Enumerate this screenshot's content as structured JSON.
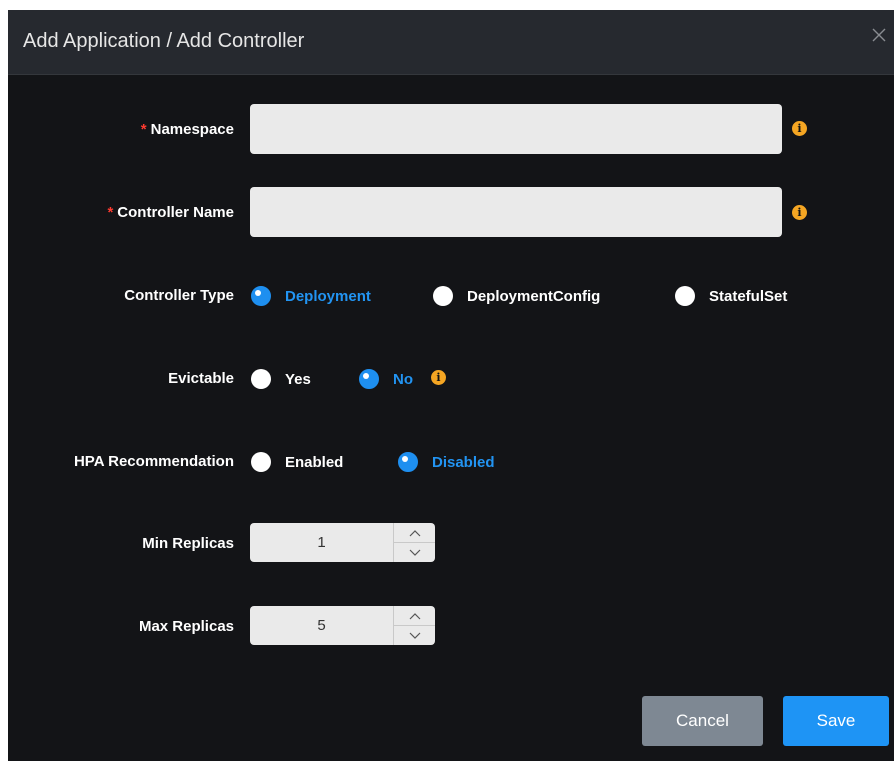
{
  "dialog": {
    "title": "Add Application / Add Controller",
    "close_icon": "close-icon"
  },
  "form": {
    "required_marker": "*",
    "namespace": {
      "label": "Namespace",
      "value": "",
      "required": true
    },
    "controller_name": {
      "label": "Controller Name",
      "value": "",
      "required": true
    },
    "controller_type": {
      "label": "Controller Type",
      "options": [
        "Deployment",
        "DeploymentConfig",
        "StatefulSet"
      ],
      "selected": "Deployment"
    },
    "evictable": {
      "label": "Evictable",
      "options": [
        "Yes",
        "No"
      ],
      "selected": "No"
    },
    "hpa_recommendation": {
      "label": "HPA Recommendation",
      "options": [
        "Enabled",
        "Disabled"
      ],
      "selected": "Disabled"
    },
    "min_replicas": {
      "label": "Min Replicas",
      "value": "1"
    },
    "max_replicas": {
      "label": "Max Replicas",
      "value": "5"
    },
    "info_icon_glyph": "i"
  },
  "footer": {
    "cancel_label": "Cancel",
    "save_label": "Save"
  },
  "colors": {
    "background": "#131417",
    "header": "#26292f",
    "accent": "#1e8ff0",
    "info": "#f5a623",
    "required": "#ff3b30",
    "cancel": "#7e8893"
  }
}
